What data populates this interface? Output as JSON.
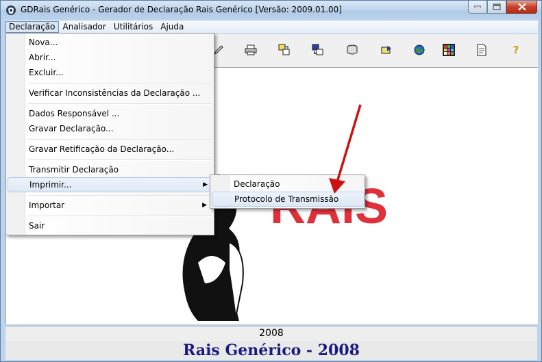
{
  "window": {
    "title": "GDRais Genérico - Gerador de Declaração Rais Genérico [Versão: 2009.01.00]"
  },
  "menubar": {
    "items": [
      {
        "label": "Declaração"
      },
      {
        "label": "Analisador"
      },
      {
        "label": "Utilitários"
      },
      {
        "label": "Ajuda"
      }
    ]
  },
  "declaracao_menu": {
    "items": [
      {
        "label": "Nova..."
      },
      {
        "label": "Abrir..."
      },
      {
        "label": "Excluir..."
      },
      {
        "label": "Verificar Inconsistências da Declaração ..."
      },
      {
        "label": "Dados Responsável ..."
      },
      {
        "label": "Gravar Declaração..."
      },
      {
        "label": "Gravar Retificação da Declaração..."
      },
      {
        "label": "Transmitir Declaração"
      },
      {
        "label": "Imprimir..."
      },
      {
        "label": "Importar"
      },
      {
        "label": "Sair"
      }
    ]
  },
  "imprimir_submenu": {
    "items": [
      {
        "label": "Declaração"
      },
      {
        "label": "Protocolo de Transmissão"
      }
    ]
  },
  "toolbar": {
    "icons": [
      "edit-icon",
      "print-icon",
      "import-icon",
      "export-icon",
      "disk-icon",
      "send-icon",
      "globe-icon",
      "grid-icon",
      "report-icon",
      "help-icon"
    ],
    "help_glyph": "?"
  },
  "logo": {
    "text": "RAIS",
    "color": "#e0303a"
  },
  "status": {
    "year": "2008",
    "footer": "Rais Genérico - 2008"
  },
  "colors": {
    "annotation_arrow": "#cc1111",
    "footer_text": "#1a1a80"
  }
}
